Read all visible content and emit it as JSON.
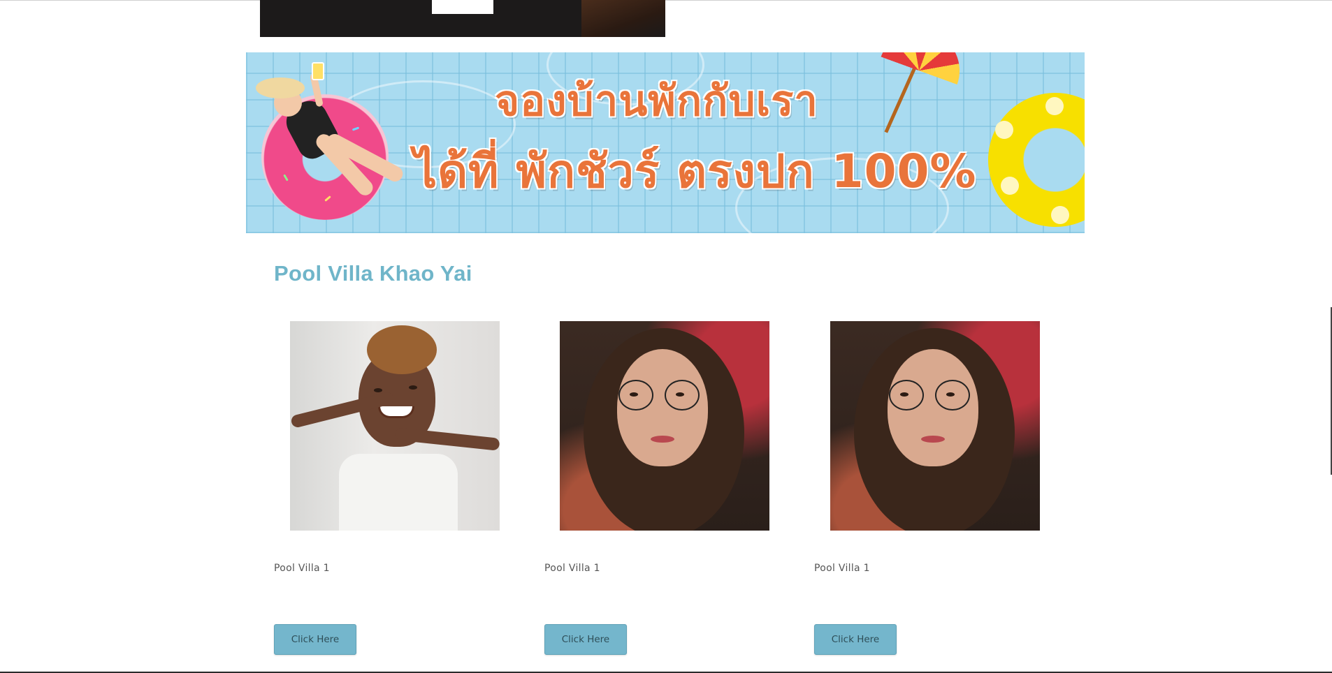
{
  "banner": {
    "line1": "จองบ้านพักกับเรา",
    "line2": "ได้ที่ พักชัวร์ ตรงปก 100%",
    "colors": {
      "text": "#e9743a",
      "water": "#a9dbf0",
      "ring": "#f7e000",
      "donut": "#f04a8a"
    }
  },
  "section": {
    "title": "Pool Villa Khao Yai",
    "title_color": "#6fb5c9"
  },
  "listings": [
    {
      "label": "Pool Villa 1",
      "button": "Click Here",
      "image": "portrait-woman-smiling"
    },
    {
      "label": "Pool Villa 1",
      "button": "Click Here",
      "image": "portrait-woman-glasses"
    },
    {
      "label": "Pool Villa 1",
      "button": "Click Here",
      "image": "portrait-woman-glasses"
    }
  ],
  "colors": {
    "button_bg": "#74b6cc",
    "button_text": "#2e4e58"
  }
}
